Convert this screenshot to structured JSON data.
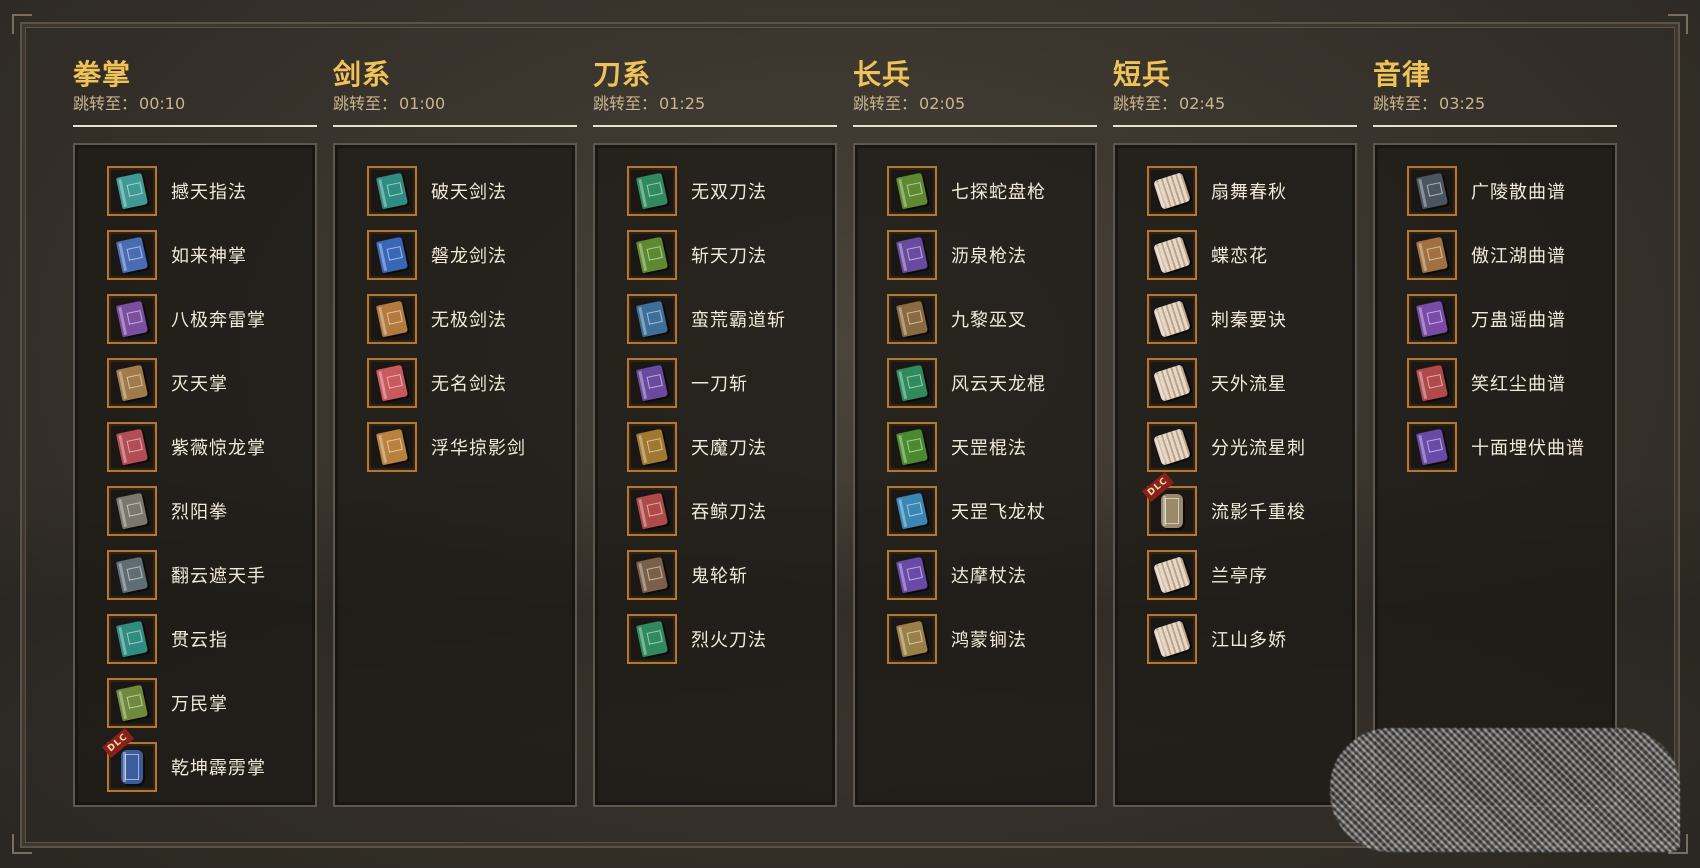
{
  "columns": [
    {
      "title": "拳掌",
      "jump_label": "跳转至：",
      "jump_time": "00:10",
      "items": [
        {
          "name": "撼天指法",
          "icon": "book-icon",
          "color": "#3f9a95",
          "dlc": false
        },
        {
          "name": "如来神掌",
          "icon": "book-icon",
          "color": "#4a6cb5",
          "dlc": false
        },
        {
          "name": "八极奔雷掌",
          "icon": "book-icon",
          "color": "#7a4fa0",
          "dlc": false
        },
        {
          "name": "灭天掌",
          "icon": "book-icon",
          "color": "#a07a4a",
          "dlc": false
        },
        {
          "name": "紫薇惊龙掌",
          "icon": "book-icon",
          "color": "#b24c55",
          "dlc": false
        },
        {
          "name": "烈阳拳",
          "icon": "book-icon",
          "color": "#7b776e",
          "dlc": false
        },
        {
          "name": "翻云遮天手",
          "icon": "book-icon",
          "color": "#5f6e73",
          "dlc": false
        },
        {
          "name": "贯云指",
          "icon": "book-icon",
          "color": "#2f8c80",
          "dlc": false
        },
        {
          "name": "万民掌",
          "icon": "book-icon",
          "color": "#6f8a3a",
          "dlc": false
        },
        {
          "name": "乾坤霹雳掌",
          "icon": "scroll-icon",
          "color": "#3d5c9e",
          "dlc": true,
          "dlc_label": "DLC"
        }
      ]
    },
    {
      "title": "剑系",
      "jump_label": "跳转至：",
      "jump_time": "01:00",
      "items": [
        {
          "name": "破天剑法",
          "icon": "book-icon",
          "color": "#2f8c80",
          "dlc": false
        },
        {
          "name": "磐龙剑法",
          "icon": "book-icon",
          "color": "#3a66b8",
          "dlc": false
        },
        {
          "name": "无极剑法",
          "icon": "book-icon",
          "color": "#b37a3e",
          "dlc": false
        },
        {
          "name": "无名剑法",
          "icon": "book-icon",
          "color": "#c85a5e",
          "dlc": false
        },
        {
          "name": "浮华掠影剑",
          "icon": "book-icon",
          "color": "#b8823e",
          "dlc": false
        }
      ]
    },
    {
      "title": "刀系",
      "jump_label": "跳转至：",
      "jump_time": "01:25",
      "items": [
        {
          "name": "无双刀法",
          "icon": "book-icon",
          "color": "#2f8a5e",
          "dlc": false
        },
        {
          "name": "斩天刀法",
          "icon": "book-icon",
          "color": "#5e8a2f",
          "dlc": false
        },
        {
          "name": "蛮荒霸道斩",
          "icon": "book-icon",
          "color": "#3d6f9a",
          "dlc": false
        },
        {
          "name": "一刀斩",
          "icon": "book-icon",
          "color": "#6a4aa0",
          "dlc": false
        },
        {
          "name": "天魔刀法",
          "icon": "book-icon",
          "color": "#a0782f",
          "dlc": false
        },
        {
          "name": "吞鲸刀法",
          "icon": "book-icon",
          "color": "#b04a4a",
          "dlc": false
        },
        {
          "name": "鬼轮斩",
          "icon": "book-icon",
          "color": "#7a6048",
          "dlc": false
        },
        {
          "name": "烈火刀法",
          "icon": "book-icon",
          "color": "#2f8a5e",
          "dlc": false
        }
      ]
    },
    {
      "title": "长兵",
      "jump_label": "跳转至：",
      "jump_time": "02:05",
      "items": [
        {
          "name": "七探蛇盘枪",
          "icon": "book-icon",
          "color": "#5e8a2f",
          "dlc": false
        },
        {
          "name": "沥泉枪法",
          "icon": "book-icon",
          "color": "#6a4aa0",
          "dlc": false
        },
        {
          "name": "九黎巫叉",
          "icon": "book-icon",
          "color": "#8a6a3e",
          "dlc": false
        },
        {
          "name": "风云天龙棍",
          "icon": "book-icon",
          "color": "#2f8a5e",
          "dlc": false
        },
        {
          "name": "天罡棍法",
          "icon": "book-icon",
          "color": "#4a8a2f",
          "dlc": false
        },
        {
          "name": "天罡飞龙杖",
          "icon": "book-icon",
          "color": "#3a86b5",
          "dlc": false
        },
        {
          "name": "达摩杖法",
          "icon": "book-icon",
          "color": "#6a4aa8",
          "dlc": false
        },
        {
          "name": "鸿蒙锏法",
          "icon": "book-icon",
          "color": "#9a8048",
          "dlc": false
        }
      ]
    },
    {
      "title": "短兵",
      "jump_label": "跳转至：",
      "jump_time": "02:45",
      "items": [
        {
          "name": "扇舞春秋",
          "icon": "fan-icon",
          "color": "#c86a78",
          "dlc": false
        },
        {
          "name": "蝶恋花",
          "icon": "fan-icon",
          "color": "#b08a5a",
          "dlc": false
        },
        {
          "name": "刺秦要诀",
          "icon": "fan-icon",
          "color": "#b85a5a",
          "dlc": false
        },
        {
          "name": "天外流星",
          "icon": "fan-icon",
          "color": "#a07850",
          "dlc": false
        },
        {
          "name": "分光流星刺",
          "icon": "fan-icon",
          "color": "#2f8a7a",
          "dlc": false
        },
        {
          "name": "流影千重梭",
          "icon": "scroll-icon",
          "color": "#9a8a6a",
          "dlc": true,
          "dlc_label": "DLC"
        },
        {
          "name": "兰亭序",
          "icon": "fan-icon",
          "color": "#b04a6a",
          "dlc": false
        },
        {
          "name": "江山多娇",
          "icon": "fan-icon",
          "color": "#2f8a6a",
          "dlc": false
        }
      ]
    },
    {
      "title": "音律",
      "jump_label": "跳转至：",
      "jump_time": "03:25",
      "items": [
        {
          "name": "广陵散曲谱",
          "icon": "book-icon",
          "color": "#4a5560",
          "dlc": false
        },
        {
          "name": "傲江湖曲谱",
          "icon": "book-icon",
          "color": "#a07040",
          "dlc": false
        },
        {
          "name": "万蛊谣曲谱",
          "icon": "book-icon",
          "color": "#7a4aa8",
          "dlc": false
        },
        {
          "name": "笑红尘曲谱",
          "icon": "book-icon",
          "color": "#b04a4a",
          "dlc": false
        },
        {
          "name": "十面埋伏曲谱",
          "icon": "book-icon",
          "color": "#6a4aa8",
          "dlc": false
        }
      ]
    }
  ]
}
